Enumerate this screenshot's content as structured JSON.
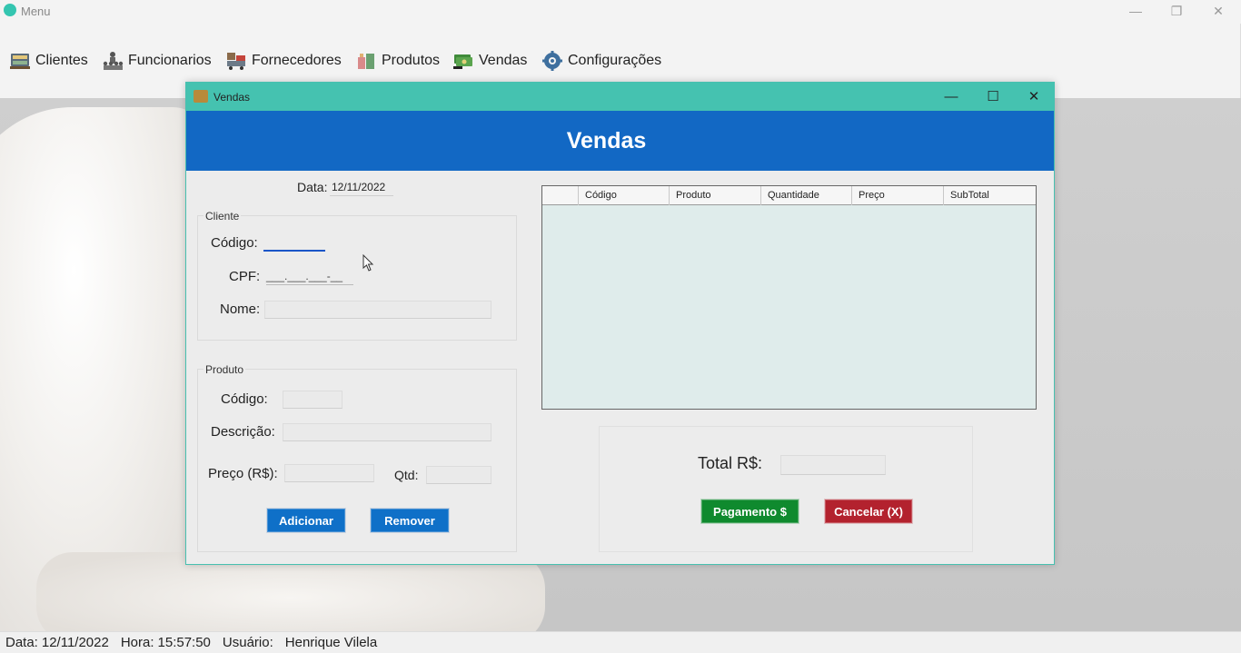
{
  "main_window": {
    "title": "Menu",
    "controls": {
      "minimize": "—",
      "restore": "❐",
      "close": "✕"
    }
  },
  "menu": {
    "items": [
      {
        "label": "Clientes",
        "icon": "clients-icon"
      },
      {
        "label": "Funcionarios",
        "icon": "employees-icon"
      },
      {
        "label": "Fornecedores",
        "icon": "suppliers-icon"
      },
      {
        "label": "Produtos",
        "icon": "products-icon"
      },
      {
        "label": "Vendas",
        "icon": "sales-icon"
      },
      {
        "label": "Configurações",
        "icon": "settings-icon"
      }
    ]
  },
  "statusbar": {
    "date_label": "Data:",
    "date_value": "12/11/2022",
    "time_label": "Hora:",
    "time_value": "15:57:50",
    "user_label": "Usuário:",
    "user_value": "Henrique Vilela"
  },
  "dialog": {
    "title": "Vendas",
    "controls": {
      "minimize": "—",
      "maximize": "☐",
      "close": "✕"
    },
    "header_title": "Vendas",
    "date_label": "Data:",
    "date_value": "12/11/2022",
    "cliente": {
      "legend": "Cliente",
      "codigo_label": "Código:",
      "cpf_label": "CPF:",
      "cpf_mask": "___.___.___-__",
      "nome_label": "Nome:"
    },
    "produto": {
      "legend": "Produto",
      "codigo_label": "Código:",
      "descricao_label": "Descrição:",
      "preco_label": "Preço (R$):",
      "qtd_label": "Qtd:",
      "add_button": "Adicionar",
      "remove_button": "Remover"
    },
    "grid": {
      "columns": [
        "Código",
        "Produto",
        "Quantidade",
        "Preço",
        "SubTotal"
      ],
      "rows": []
    },
    "total": {
      "label": "Total R$:",
      "pay_button": "Pagamento $",
      "cancel_button": "Cancelar (X)"
    }
  },
  "colors": {
    "dialog_titlebar": "#45c2b0",
    "header": "#1268c4",
    "pay_button": "#0f8a2e",
    "cancel_button": "#b3222e",
    "action_button": "#0f70c8"
  }
}
